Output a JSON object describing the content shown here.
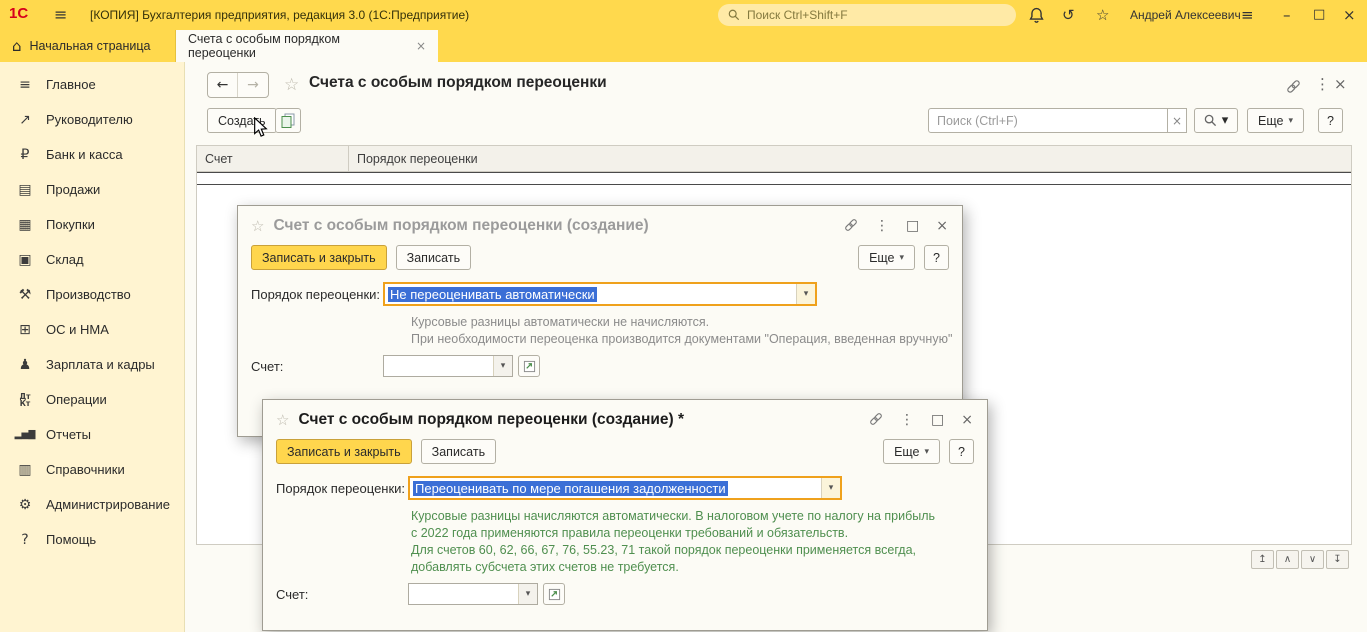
{
  "colors": {
    "brand_yellow": "#ffd94d",
    "sidebar_yellow": "#fff4d1",
    "selection_blue": "#3b6fd6",
    "hint_green": "#4f8f4f",
    "hint_gray": "#8b8b8b",
    "focus_orange": "#efa11c"
  },
  "icons": {
    "menu": "≡",
    "home": "⌂",
    "star": "☆",
    "history": "↺",
    "minimize": "–",
    "maximize": "□",
    "close": "×",
    "dots": "⋮",
    "back": "←",
    "forward": "→",
    "dropdown": "▾",
    "clear": "×",
    "nav_first": "↥",
    "nav_up": "∧",
    "nav_down": "∨",
    "nav_last": "↧"
  },
  "titlebar": {
    "logo": "1С",
    "title": "[КОПИЯ] Бухгалтерия предприятия, редакция 3.0  (1С:Предприятие)",
    "search_placeholder": "Поиск Ctrl+Shift+F",
    "user_name": "Андрей Алексеевич"
  },
  "tabs": [
    {
      "label": "Начальная страница"
    },
    {
      "label": "Счета с особым порядком переоценки"
    }
  ],
  "sidebar": [
    {
      "icon": "≡",
      "label": "Главное"
    },
    {
      "icon": "↗",
      "label": "Руководителю"
    },
    {
      "icon": "₽",
      "label": "Банк и касса"
    },
    {
      "icon": "▤",
      "label": "Продажи"
    },
    {
      "icon": "▦",
      "label": "Покупки"
    },
    {
      "icon": "▣",
      "label": "Склад"
    },
    {
      "icon": "⚒",
      "label": "Производство"
    },
    {
      "icon": "⊞",
      "label": "ОС и НМА"
    },
    {
      "icon": "♟",
      "label": "Зарплата и кадры"
    },
    {
      "icon": "Дт\nКт",
      "label": "Операции"
    },
    {
      "icon": "▂▅▇",
      "label": "Отчеты"
    },
    {
      "icon": "▥",
      "label": "Справочники"
    },
    {
      "icon": "⚙",
      "label": "Администрирование"
    },
    {
      "icon": "?",
      "label": "Помощь"
    }
  ],
  "list_form": {
    "title": "Счета с особым порядком переоценки",
    "create_button": "Создать",
    "search_placeholder": "Поиск (Ctrl+F)",
    "more_button": "Еще",
    "help_button": "?",
    "columns": [
      "Счет",
      "Порядок переоценки"
    ]
  },
  "dialogs": [
    {
      "title": "Счет с особым порядком переоценки (создание)",
      "save_close_button": "Записать и закрыть",
      "save_button": "Записать",
      "more_button": "Еще",
      "help_button": "?",
      "revaluation_label": "Порядок переоценки:",
      "revaluation_value": "Не переоценивать автоматически",
      "hint_lines": [
        "Курсовые разницы автоматически не начисляются.",
        "При необходимости переоценка производится документами \"Операция, введенная вручную\""
      ],
      "account_label": "Счет:"
    },
    {
      "title": "Счет с особым порядком переоценки (создание) *",
      "save_close_button": "Записать и закрыть",
      "save_button": "Записать",
      "more_button": "Еще",
      "help_button": "?",
      "revaluation_label": "Порядок переоценки:",
      "revaluation_value": "Переоценивать по мере погашения задолженности",
      "hint_lines": [
        "Курсовые разницы начисляются автоматически. В налоговом учете по налогу на прибыль",
        "с 2022 года применяются правила переоценки требований и обязательств.",
        "Для счетов 60, 62, 66, 67, 76, 55.23, 71 такой порядок переоценки применяется всегда,",
        "добавлять субсчета этих счетов не требуется."
      ],
      "account_label": "Счет:"
    }
  ]
}
